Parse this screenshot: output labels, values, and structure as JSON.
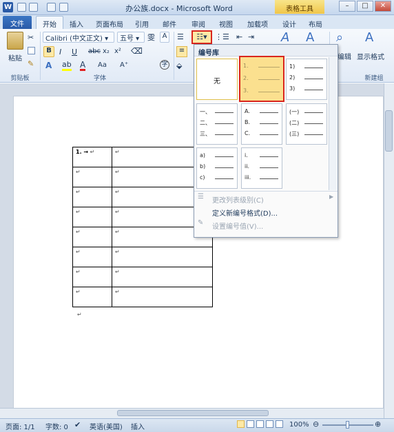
{
  "window": {
    "title": "办公族.docx - Microsoft Word",
    "context_tab": "表格工具",
    "controls": [
      "–",
      "□",
      "✕"
    ]
  },
  "tabs": [
    "文件",
    "开始",
    "插入",
    "页面布局",
    "引用",
    "邮件",
    "审阅",
    "视图",
    "加载项",
    "设计",
    "布局"
  ],
  "ribbon": {
    "paste": "粘贴",
    "font_name": "Calibri (中文正文)",
    "font_size": "五号",
    "bold": "B",
    "italic": "I",
    "underline": "U",
    "strike": "abc",
    "subscript": "x₂",
    "superscript": "x²",
    "grow_font": "A⁺",
    "shrink_font": "A⁻",
    "case": "Aa",
    "clipboard_label": "剪贴板",
    "font_label": "字体",
    "show_format": "显示格式",
    "new_group": "新建组",
    "edit": "编辑"
  },
  "dropdown": {
    "header": "编号库",
    "none_label": "无",
    "lib_numeric": [
      "1.",
      "2.",
      "3."
    ],
    "lib_paren": [
      "1)",
      "2)",
      "3)"
    ],
    "lib_chinese": [
      "一、",
      "二、",
      "三、"
    ],
    "lib_alpha_upper": [
      "A.",
      "B.",
      "C."
    ],
    "lib_chinese_paren": [
      "(一)",
      "(二)",
      "(三)"
    ],
    "lib_alpha_lower": [
      "a)",
      "b)",
      "c)"
    ],
    "lib_roman": [
      "i.",
      "ii.",
      "iii."
    ],
    "menu": [
      {
        "label": "更改列表级别(C)",
        "disabled": true
      },
      {
        "label": "定义新编号格式(D)...",
        "disabled": false
      },
      {
        "label": "设置编号值(V)...",
        "disabled": true
      }
    ]
  },
  "table": {
    "first_cell": "1. →",
    "mark": "↵"
  },
  "status": {
    "page": "页面: 1/1",
    "words": "字数: 0",
    "lang": "英语(美国)",
    "insert": "插入",
    "zoom": "100%"
  }
}
